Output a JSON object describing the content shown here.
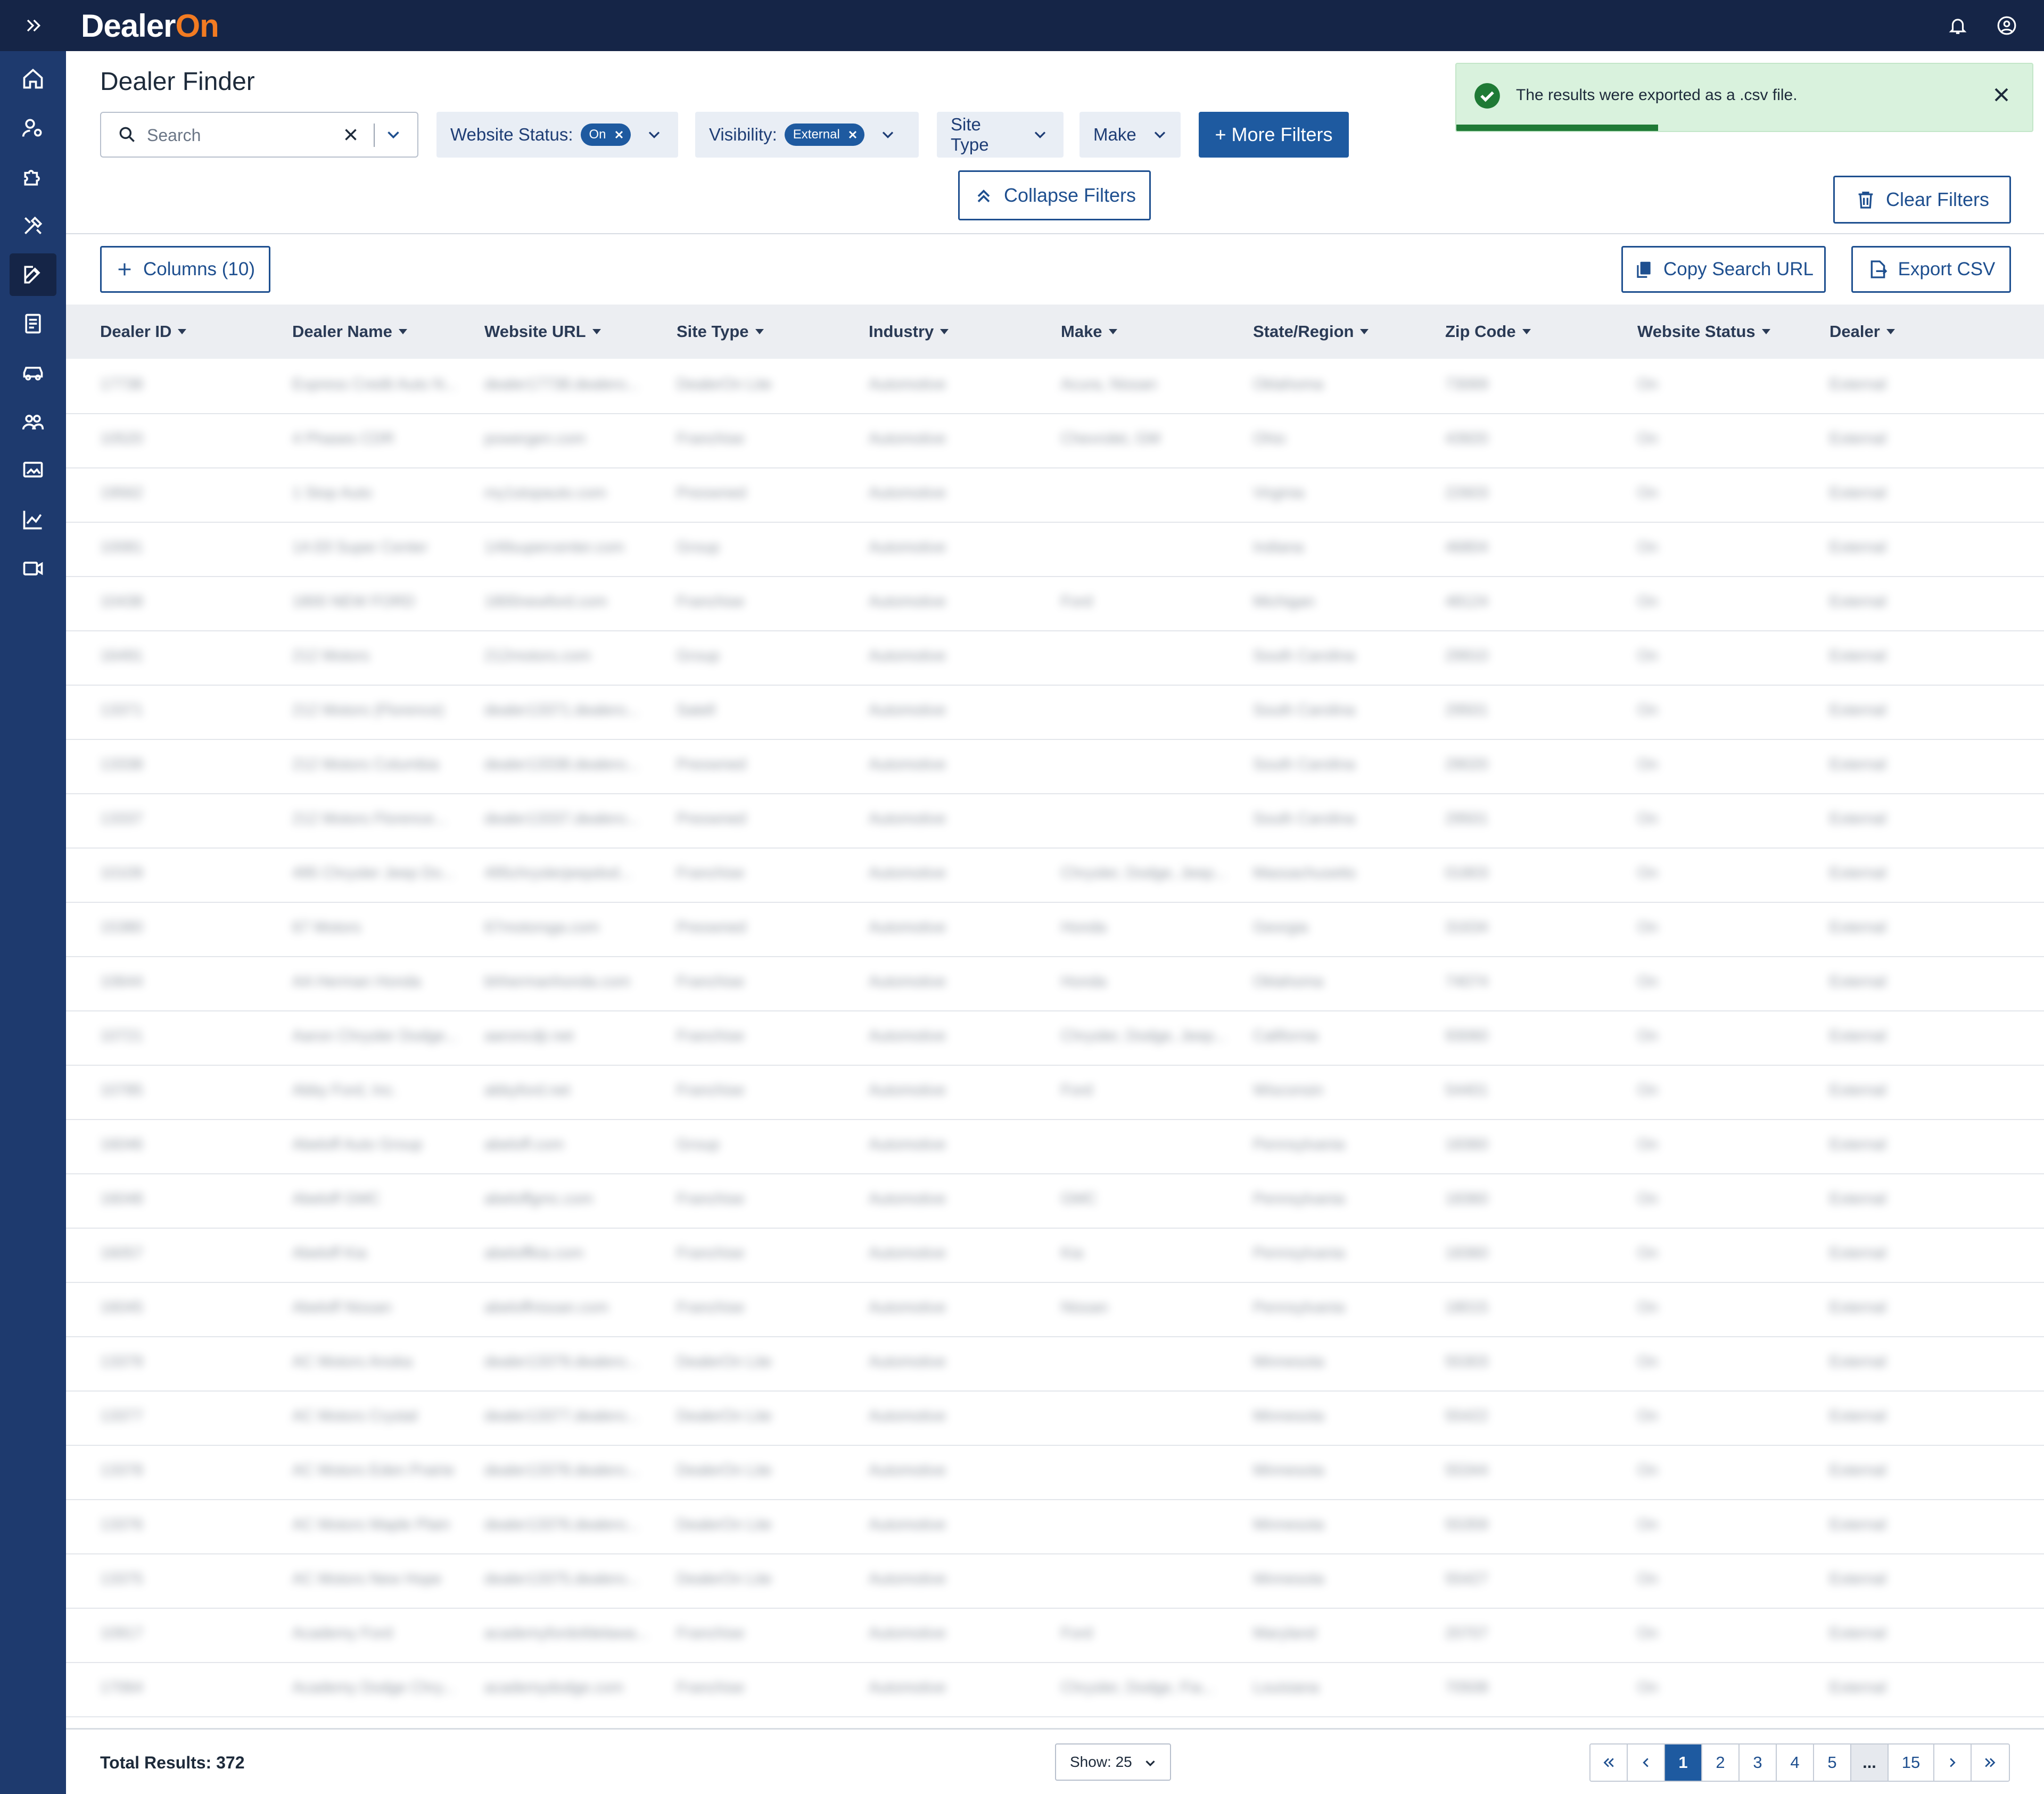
{
  "app": {
    "logo_prefix": "Dealer",
    "logo_suffix": "On"
  },
  "page": {
    "title": "Dealer Finder"
  },
  "search": {
    "placeholder": "Search",
    "value": ""
  },
  "filters": {
    "website_status": {
      "label": "Website Status:",
      "value": "On"
    },
    "visibility": {
      "label": "Visibility:",
      "value": "External"
    },
    "site_type": {
      "label": "Site Type"
    },
    "make": {
      "label": "Make"
    },
    "more_filters": "+ More Filters",
    "collapse_filters": "Collapse Filters",
    "clear_filters": "Clear Filters"
  },
  "toast": {
    "message": "The results were exported as a .csv file.",
    "progress": 0.35
  },
  "toolbar": {
    "columns": "Columns (10)",
    "copy_search_url": "Copy Search URL",
    "export_csv": "Export CSV"
  },
  "table": {
    "columns": [
      "Dealer ID",
      "Dealer Name",
      "Website URL",
      "Site Type",
      "Industry",
      "Make",
      "State/Region",
      "Zip Code",
      "Website Status",
      "Dealer"
    ],
    "rows": [
      [
        "17738",
        "Express Credit Auto N...",
        "dealer17738.dealero...",
        "DealerOn Lite",
        "Automotive",
        "Acura, Nissan",
        "Oklahoma",
        "73069",
        "On",
        "External"
      ],
      [
        "10520",
        "4 Phases CDR",
        "powergen.com",
        "Franchise",
        "Automotive",
        "Chevrolet, GM",
        "Ohio",
        "43920",
        "On",
        "External"
      ],
      [
        "19562",
        "1 Stop Auto",
        "my1stopauto.com",
        "Preowned",
        "Automotive",
        "",
        "Virginia",
        "22603",
        "On",
        "External"
      ],
      [
        "10081",
        "1A Ell Super Center",
        "1Allsupercenter.com",
        "Group",
        "Automotive",
        "",
        "Indiana",
        "46804",
        "On",
        "External"
      ],
      [
        "10438",
        "1800 NEW FORD",
        "1800newford.com",
        "Franchise",
        "Automotive",
        "Ford",
        "Michigan",
        "48124",
        "On",
        "External"
      ],
      [
        "16491",
        "212 Motors",
        "212motors.com",
        "Group",
        "Automotive",
        "",
        "South Carolina",
        "29910",
        "On",
        "External"
      ],
      [
        "13371",
        "212 Motors (Florence)",
        "dealer13371.dealero...",
        "Satell",
        "Automotive",
        "",
        "South Carolina",
        "29501",
        "On",
        "External"
      ],
      [
        "13338",
        "212 Motors Columbia",
        "dealer13338.dealero...",
        "Preowned",
        "Automotive",
        "",
        "South Carolina",
        "29020",
        "On",
        "External"
      ],
      [
        "13337",
        "212 Motors Florence...",
        "dealer13337.dealero...",
        "Preowned",
        "Automotive",
        "",
        "South Carolina",
        "29501",
        "On",
        "External"
      ],
      [
        "10109",
        "495 Chrysler Jeep Do...",
        "495chryslerjeepdod...",
        "Franchise",
        "Automotive",
        "Chrysler, Dodge, Jeep...",
        "Massachusetts",
        "01803",
        "On",
        "External"
      ],
      [
        "15380",
        "67 Motors",
        "67motorsga.com",
        "Preowned",
        "Automotive",
        "Honda",
        "Georgia",
        "31634",
        "On",
        "External"
      ],
      [
        "10644",
        "AA Herman Honda",
        "bhhermanhonda.com",
        "Franchise",
        "Automotive",
        "Honda",
        "Oklahoma",
        "74074",
        "On",
        "External"
      ],
      [
        "10721",
        "Aaron Chrysler Dodge...",
        "aaroncdjr.net",
        "Franchise",
        "Automotive",
        "Chrysler, Dodge, Jeep...",
        "California",
        "93060",
        "On",
        "External"
      ],
      [
        "10785",
        "Abby Ford, Inc.",
        "abbyford.net",
        "Franchise",
        "Automotive",
        "Ford",
        "Wisconsin",
        "54401",
        "On",
        "External"
      ],
      [
        "16046",
        "Abeloff Auto Group",
        "abeloff.com",
        "Group",
        "Automotive",
        "",
        "Pennsylvania",
        "18360",
        "On",
        "External"
      ],
      [
        "16048",
        "Abeloff GMC",
        "abeloffgmc.com",
        "Franchise",
        "Automotive",
        "GMC",
        "Pennsylvania",
        "18360",
        "On",
        "External"
      ],
      [
        "16057",
        "Abeloff Kia",
        "abeloffkia.com",
        "Franchise",
        "Automotive",
        "Kia",
        "Pennsylvania",
        "18360",
        "On",
        "External"
      ],
      [
        "16045",
        "Abeloff Nissan",
        "abeloffnissan.com",
        "Franchise",
        "Automotive",
        "Nissan",
        "Pennsylvania",
        "18015",
        "On",
        "External"
      ],
      [
        "13379",
        "AC Motors Anoka",
        "dealer13379.dealero...",
        "DealerOn Lite",
        "Automotive",
        "",
        "Minnesota",
        "55303",
        "On",
        "External"
      ],
      [
        "13377",
        "AC Motors Crystal",
        "dealer13377.dealero...",
        "DealerOn Lite",
        "Automotive",
        "",
        "Minnesota",
        "55422",
        "On",
        "External"
      ],
      [
        "13378",
        "AC Motors Eden Prairie",
        "dealer13378.dealero...",
        "DealerOn Lite",
        "Automotive",
        "",
        "Minnesota",
        "55344",
        "On",
        "External"
      ],
      [
        "13376",
        "AC Motors Maple Plain",
        "dealer13376.dealero...",
        "DealerOn Lite",
        "Automotive",
        "",
        "Minnesota",
        "55359",
        "On",
        "External"
      ],
      [
        "13375",
        "AC Motors New Hope",
        "dealer13375.dealero...",
        "DealerOn Lite",
        "Automotive",
        "",
        "Minnesota",
        "55427",
        "On",
        "External"
      ],
      [
        "10917",
        "Academy Ford",
        "academyfordofdelawa...",
        "Franchise",
        "Automotive",
        "Ford",
        "Maryland",
        "20707",
        "On",
        "External"
      ],
      [
        "17064",
        "Academy Dodge Chry...",
        "academydodge.com",
        "Franchise",
        "Automotive",
        "Chrysler, Dodge, Fia...",
        "Louisiana",
        "70508",
        "On",
        "External"
      ]
    ]
  },
  "footer": {
    "total_results": "Total Results: 372",
    "show": "Show: 25",
    "pages": [
      "1",
      "2",
      "3",
      "4",
      "5",
      "...",
      "15"
    ]
  },
  "icons": {
    "accent": "#1e5aa0",
    "brand_orange": "#f27b22",
    "nav_bg": "#152547",
    "rail_bg": "#1e3a6e",
    "success": "#1f7a35"
  }
}
